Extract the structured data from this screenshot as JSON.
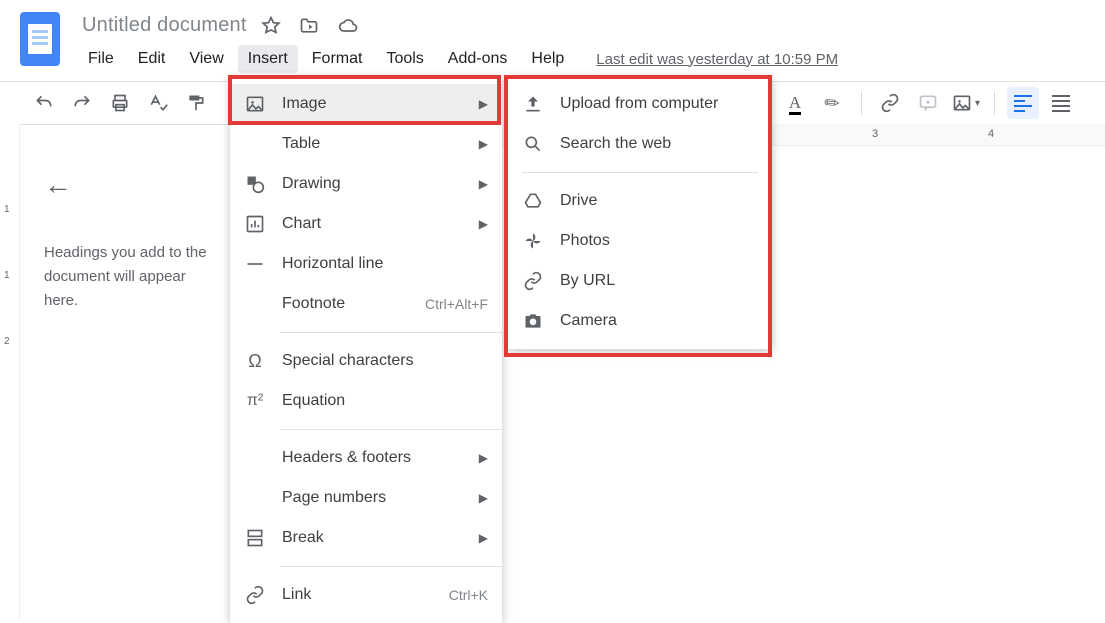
{
  "doc_title": "Untitled document",
  "menubar": {
    "file": "File",
    "edit": "Edit",
    "view": "View",
    "insert": "Insert",
    "format": "Format",
    "tools": "Tools",
    "addons": "Add-ons",
    "help": "Help"
  },
  "last_edit": "Last edit was yesterday at 10:59 PM",
  "outline": {
    "hint": "Headings you add to the document will appear here."
  },
  "h_ruler_numbers": {
    "n3": "3",
    "n4": "4"
  },
  "v_ruler": {
    "n1a": "1",
    "n1b": "1",
    "n2": "2"
  },
  "insert_menu": {
    "image": "Image",
    "table": "Table",
    "drawing": "Drawing",
    "chart": "Chart",
    "hline": "Horizontal line",
    "footnote": "Footnote",
    "footnote_shortcut": "Ctrl+Alt+F",
    "special": "Special characters",
    "equation": "Equation",
    "hf": "Headers & footers",
    "pagenum": "Page numbers",
    "break": "Break",
    "link": "Link",
    "link_shortcut": "Ctrl+K"
  },
  "image_submenu": {
    "upload": "Upload from computer",
    "search": "Search the web",
    "drive": "Drive",
    "photos": "Photos",
    "byurl": "By URL",
    "camera": "Camera"
  }
}
